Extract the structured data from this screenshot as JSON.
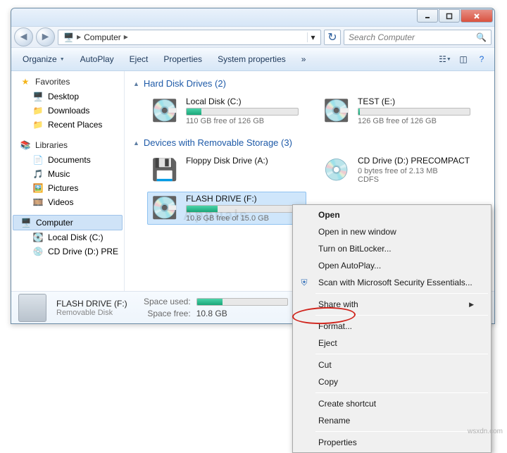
{
  "watermark": "Appuals",
  "credit": "wsxdn.com",
  "title_buttons": {
    "min": "—",
    "max": "❐",
    "close": "✕"
  },
  "address": {
    "crumb_root_icon": "🖥",
    "crumb_root": "Computer",
    "search_placeholder": "Search Computer"
  },
  "toolbar": {
    "organize": "Organize",
    "autoplay": "AutoPlay",
    "eject": "Eject",
    "properties": "Properties",
    "system_properties": "System properties",
    "overflow": "»"
  },
  "nav": {
    "favorites": {
      "label": "Favorites",
      "items": [
        "Desktop",
        "Downloads",
        "Recent Places"
      ]
    },
    "libraries": {
      "label": "Libraries",
      "items": [
        "Documents",
        "Music",
        "Pictures",
        "Videos"
      ]
    },
    "computer": {
      "label": "Computer",
      "items": [
        "Local Disk (C:)",
        "CD Drive (D:) PRE"
      ]
    }
  },
  "groups": {
    "hdd": {
      "title": "Hard Disk Drives (2)",
      "drives": [
        {
          "name": "Local Disk (C:)",
          "free": "110 GB free of 126 GB",
          "fill_pct": 13
        },
        {
          "name": "TEST (E:)",
          "free": "126 GB free of 126 GB",
          "fill_pct": 1
        }
      ]
    },
    "removable": {
      "title": "Devices with Removable Storage (3)",
      "drives": [
        {
          "name": "Floppy Disk Drive (A:)",
          "free": "",
          "fill_pct": null
        },
        {
          "name": "CD Drive (D:) PRECOMPACT",
          "free": "0 bytes free of 2.13 MB",
          "sub": "CDFS",
          "fill_pct": null
        },
        {
          "name": "FLASH DRIVE (F:)",
          "free": "10.8 GB free of 15.0 GB",
          "fill_pct": 28
        }
      ]
    }
  },
  "status": {
    "name": "FLASH DRIVE (F:)",
    "type": "Removable Disk",
    "used_label": "Space used:",
    "free_label": "Space free:",
    "free_value": "10.8 GB",
    "used_pct": 28
  },
  "ctx": {
    "open": "Open",
    "open_new": "Open in new window",
    "bitlocker": "Turn on BitLocker...",
    "autoplay": "Open AutoPlay...",
    "scan": "Scan with Microsoft Security Essentials...",
    "share": "Share with",
    "format": "Format...",
    "eject": "Eject",
    "cut": "Cut",
    "copy": "Copy",
    "shortcut": "Create shortcut",
    "rename": "Rename",
    "properties": "Properties"
  }
}
